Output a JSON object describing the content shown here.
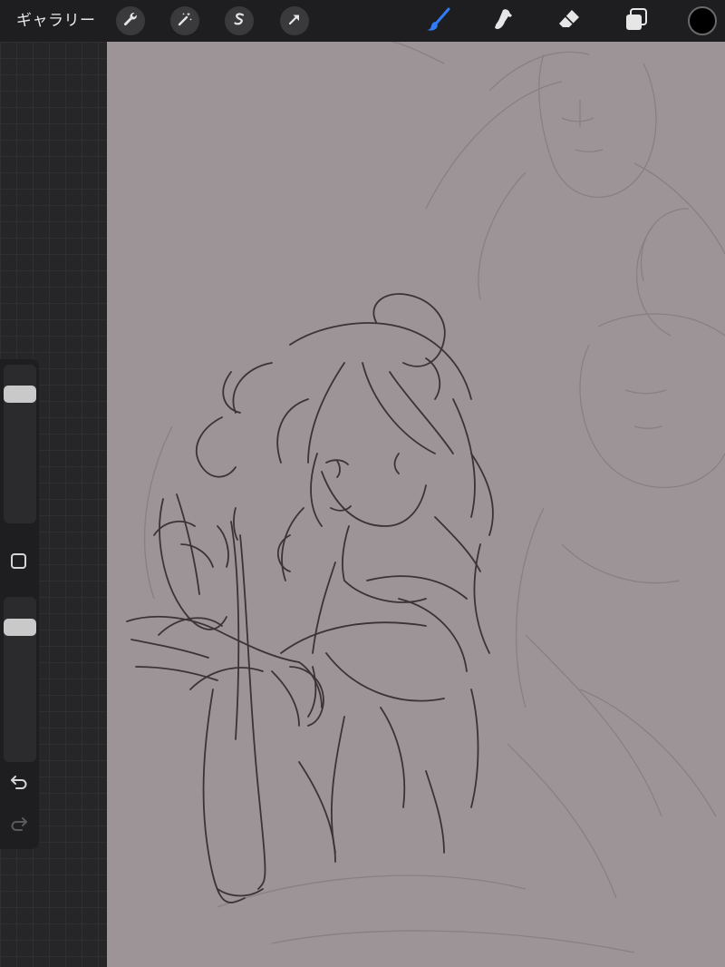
{
  "topbar": {
    "gallery_label": "ギャラリー",
    "left_tools": [
      "wrench-icon",
      "magic-wand-icon",
      "selection-icon",
      "transform-arrow-icon"
    ],
    "right_tools": [
      "brush-icon",
      "smudge-icon",
      "eraser-icon",
      "layers-icon"
    ],
    "active_tool": "brush-icon",
    "current_color": "#000000"
  },
  "sidebar": {
    "brush_size": 0.85,
    "opacity": 0.85,
    "buttons": [
      "modify-square-icon",
      "undo-icon",
      "redo-icon"
    ]
  },
  "colors": {
    "accent": "#2f7cf6",
    "canvas": "#9c9496",
    "ui_dark": "#1e1e20"
  }
}
